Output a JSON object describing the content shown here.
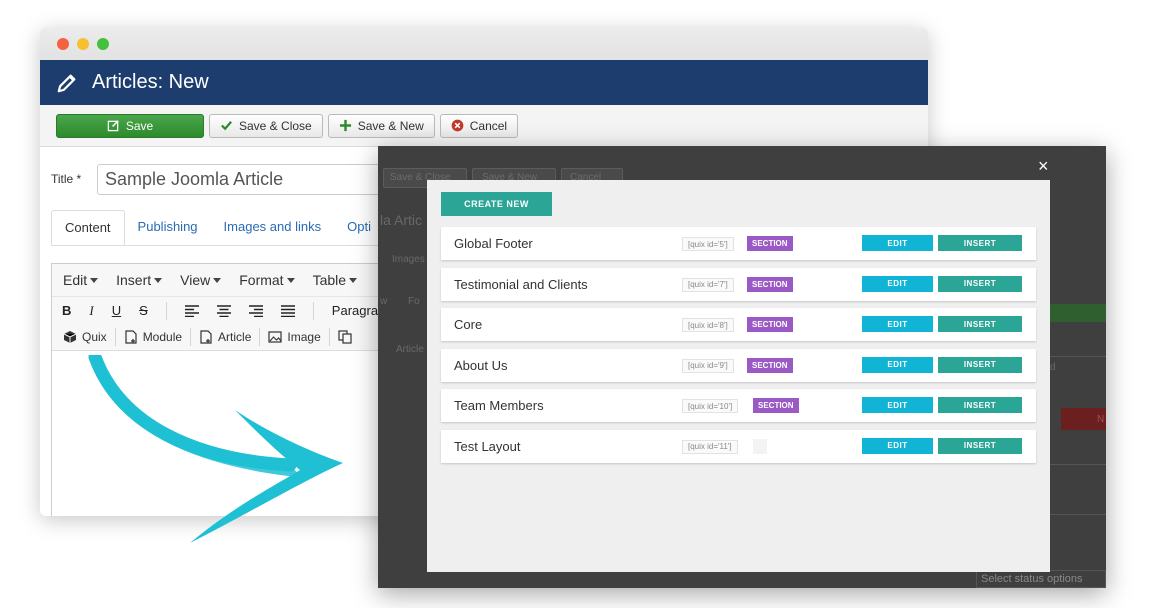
{
  "window": {
    "title": "Articles: New"
  },
  "toolbar": {
    "save_label": "Save",
    "save_close_label": "Save & Close",
    "save_new_label": "Save & New",
    "cancel_label": "Cancel"
  },
  "form": {
    "title_label": "Title *",
    "title_value": "Sample Joomla Article"
  },
  "tabs": [
    "Content",
    "Publishing",
    "Images and links",
    "Opti"
  ],
  "editor": {
    "menus": [
      "Edit",
      "Insert",
      "View",
      "Format",
      "Table"
    ],
    "format_buttons": [
      "B",
      "I",
      "U",
      "S"
    ],
    "paragraph_label": "Paragraph",
    "insert_buttons": [
      "Quix",
      "Module",
      "Article",
      "Image"
    ]
  },
  "background_ghost": {
    "save_close": "Save & Close",
    "save_new": "Save & New",
    "cancel": "Cancel",
    "title_fragment": "la Artic",
    "images_fragment": "Images",
    "w_fragment": "w",
    "fo_fragment": "Fo",
    "article_fragment": "Article",
    "n_fragment": "N",
    "d_fragment": "d",
    "footer_text": "Select status options"
  },
  "modal": {
    "close_symbol": "×",
    "create_label": "CREATE NEW",
    "edit_label": "EDIT",
    "insert_label": "INSERT",
    "rows": [
      {
        "name": "Global Footer",
        "shortcode": "[quix id='5']",
        "badge": "SECTION"
      },
      {
        "name": "Testimonial and Clients",
        "shortcode": "[quix id='7']",
        "badge": "SECTION"
      },
      {
        "name": "Core",
        "shortcode": "[quix id='8']",
        "badge": "SECTION"
      },
      {
        "name": "About Us",
        "shortcode": "[quix id='9']",
        "badge": "SECTION"
      },
      {
        "name": "Team Members",
        "shortcode": "[quix id='10']",
        "badge": "SECTION"
      },
      {
        "name": "Test Layout",
        "shortcode": "[quix id='11']",
        "badge": ""
      }
    ]
  },
  "colors": {
    "header": "#1c3d6e",
    "save": "#3a9a3a",
    "teal": "#2aa596",
    "cyan": "#12b4d6",
    "purple": "#9b59c6",
    "arrow": "#1fbfd4"
  }
}
